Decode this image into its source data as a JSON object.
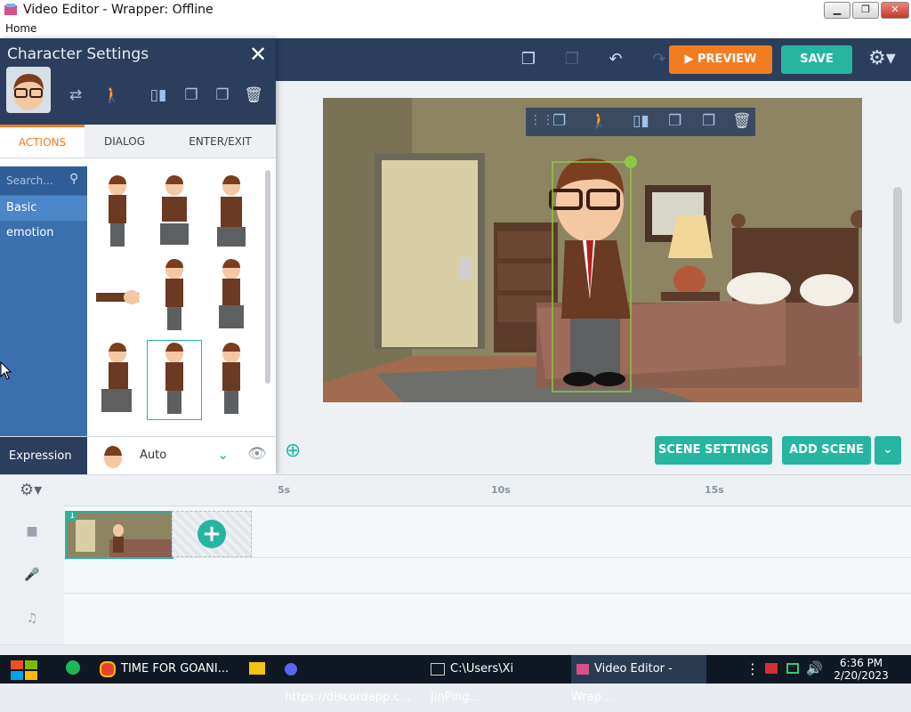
{
  "window": {
    "title": "Video Editor - Wrapper: Offline",
    "min_label": "▁",
    "max_label": "❐",
    "close_label": "✕"
  },
  "menu": {
    "home": "Home"
  },
  "header": {
    "preview_label": "PREVIEW",
    "save_label": "SAVE"
  },
  "panel": {
    "title": "Character Settings",
    "close_label": "✕",
    "tabs": [
      "ACTIONS",
      "DIALOG",
      "ENTER/EXIT"
    ],
    "search_placeholder": "Search...",
    "categories": [
      "Basic",
      "emotion"
    ],
    "expression_label": "Expression",
    "expression_value": "Auto"
  },
  "stage": {
    "scene_settings_label": "SCENE SETTINGS",
    "add_scene_label": "ADD SCENE"
  },
  "timeline": {
    "ticks": [
      "5s",
      "10s",
      "15s"
    ],
    "scene_number": "1"
  },
  "taskbar": {
    "items": [
      "TIME FOR GOANI...",
      "https://discordapp.c...",
      "C:\\Users\\Xi JinPing...",
      "Video Editor - Wrap..."
    ],
    "time": "6:36 PM",
    "date": "2/20/2023"
  },
  "colors": {
    "accent_teal": "#26b5a1",
    "accent_orange": "#f47c20",
    "header_navy": "#2c3e5d",
    "category_blue": "#3b6fae"
  }
}
